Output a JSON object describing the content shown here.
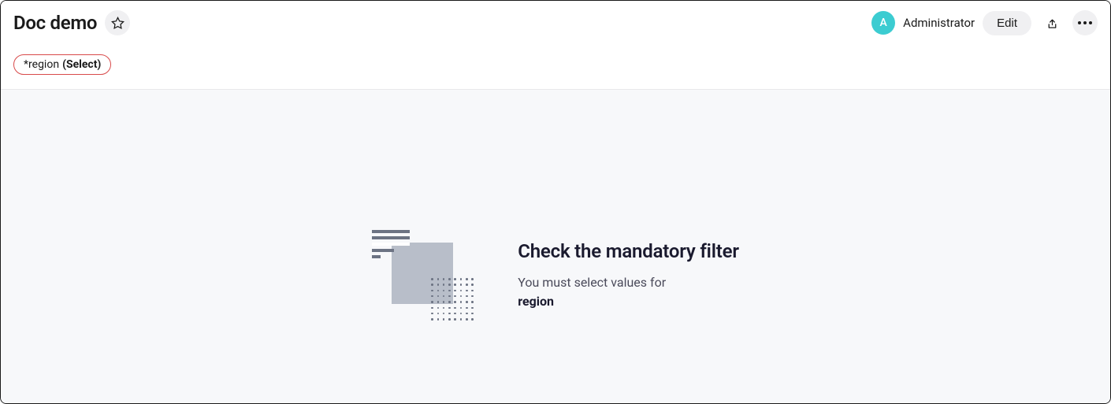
{
  "header": {
    "title": "Doc demo",
    "avatar_letter": "A",
    "user_name": "Administrator",
    "edit_label": "Edit"
  },
  "filter": {
    "prefix": "*region",
    "select_label": "(Select)"
  },
  "empty_state": {
    "title": "Check the mandatory filter",
    "description": "You must select values for",
    "filter_name": "region"
  }
}
